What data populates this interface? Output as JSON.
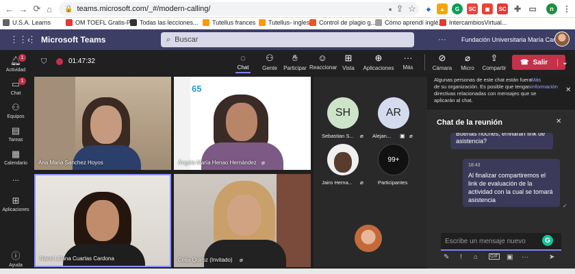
{
  "browser": {
    "url": "teams.microsoft.com/_#/modern-calling/",
    "bookmarks": [
      "U.S.A. Learns",
      "OM TOEFL Gratis-Pr...",
      "Todas las lecciones...",
      "Tutellus frances",
      "Tutellus- ingles",
      "Control de plagio g...",
      "Cómo aprendí inglé...",
      "IntercambiosVirtual..."
    ],
    "profile_initial": "n"
  },
  "teams": {
    "brand": "Microsoft Teams",
    "search_placeholder": "Buscar",
    "org_name": "Fundación Universitaria María Cano"
  },
  "rail": [
    {
      "label": "Actividad",
      "badge": "1"
    },
    {
      "label": "Chat",
      "badge": "1"
    },
    {
      "label": "Equipos",
      "badge": ""
    },
    {
      "label": "Tareas",
      "badge": ""
    },
    {
      "label": "Calendario",
      "badge": ""
    },
    {
      "label": "...",
      "badge": ""
    },
    {
      "label": "Aplicaciones",
      "badge": ""
    },
    {
      "label": "Ayuda",
      "badge": ""
    }
  ],
  "meeting": {
    "timer": "01:47:32",
    "toolbar": [
      "Chat",
      "Gente",
      "Participar",
      "Reaccionar",
      "Vista",
      "Aplicaciones",
      "Más",
      "Cámara",
      "Micro",
      "Compartir"
    ],
    "leave_label": "Salir"
  },
  "tiles": [
    {
      "name": "Ana Maria Sanchez Hoyos"
    },
    {
      "name": "Ángela María Henao Hernández"
    },
    {
      "name": "Nanci Liliana Cuartas Cardona"
    },
    {
      "name": "Celia Quiroz (Invitado)"
    }
  ],
  "roster": [
    {
      "initials": "SH",
      "name": "Sebastian S..."
    },
    {
      "initials": "AR",
      "name": "Alejan..."
    },
    {
      "initials": "",
      "name": "Jairo Herna..."
    },
    {
      "initials": "99+",
      "name": "Participantes"
    }
  ],
  "chat": {
    "notice": "Algunas personas de este chat están fuera de su organización. Es posible que tengan directivas relacionadas con mensajes que se aplicarán al chat.",
    "more_info": "Más información",
    "title": "Chat de la reunión",
    "message_prev": "Buenas noches, enviaran link de asistencia?",
    "message_time": "18:43",
    "message_text": "Al finalizar compartiremos el link de evaluación de la actividad con la cual se tomará asistencia",
    "composer_placeholder": "Escribe un mensaje nuevo"
  }
}
